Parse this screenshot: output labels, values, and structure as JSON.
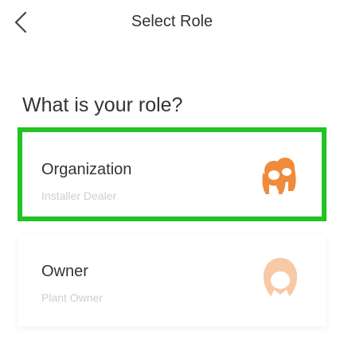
{
  "header": {
    "title": "Select Role",
    "back_icon": "chevron-left-icon"
  },
  "question": "What is your role?",
  "roles": [
    {
      "title": "Organization",
      "subtitle": "Installer Dealer",
      "icon": "organization-icon",
      "selected": true
    },
    {
      "title": "Owner",
      "subtitle": "Plant Owner",
      "icon": "owner-icon",
      "selected": false
    }
  ],
  "colors": {
    "selected_border": "#22c322",
    "icon_orange": "#f08a3c",
    "text_primary": "#333333",
    "text_secondary": "#cfcfcf"
  }
}
